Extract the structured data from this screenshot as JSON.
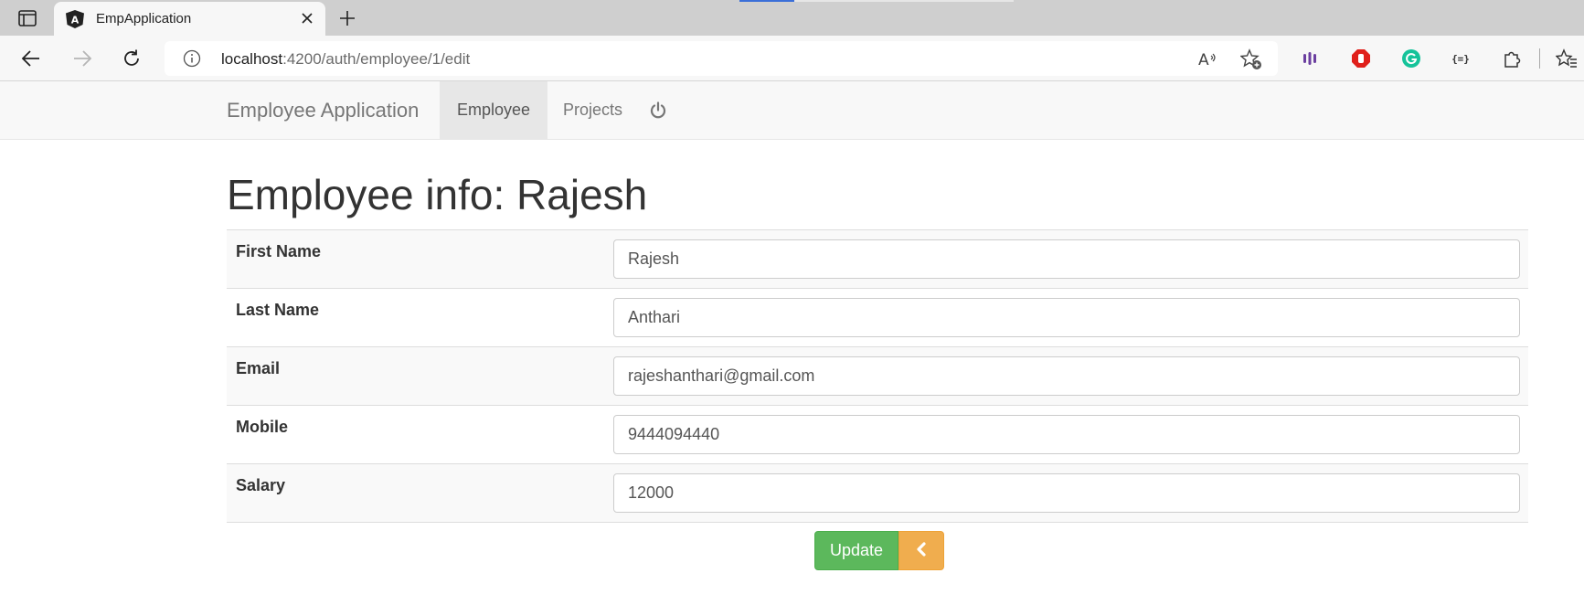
{
  "browser": {
    "tab_title": "EmpApplication",
    "url_host": "localhost",
    "url_path": ":4200/auth/employee/1/edit"
  },
  "navbar": {
    "brand": "Employee Application",
    "links": [
      {
        "label": "Employee",
        "active": true
      },
      {
        "label": "Projects",
        "active": false
      }
    ],
    "logout_icon": "power-icon"
  },
  "page": {
    "heading": "Employee info: Rajesh"
  },
  "form": {
    "fields": [
      {
        "label": "First Name",
        "value": "Rajesh"
      },
      {
        "label": "Last Name",
        "value": "Anthari"
      },
      {
        "label": "Email",
        "value": "rajeshanthari@gmail.com"
      },
      {
        "label": "Mobile",
        "value": "9444094440"
      },
      {
        "label": "Salary",
        "value": "12000"
      }
    ],
    "update_label": "Update",
    "back_icon": "chevron-left-icon"
  },
  "colors": {
    "update_button": "#5cb85c",
    "back_button": "#f0ad4e",
    "navbar_bg": "#f8f8f8"
  }
}
